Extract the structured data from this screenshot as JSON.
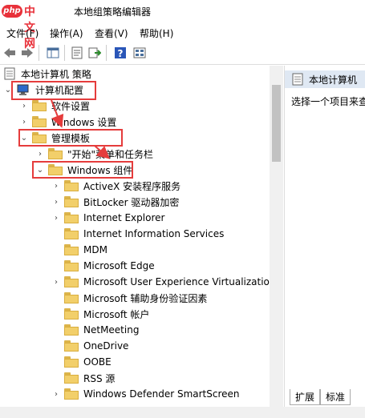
{
  "window": {
    "title": "本地组策略编辑器",
    "logo_text": "php",
    "logo_cn": "中文网"
  },
  "menu": [
    "文件(F)",
    "操作(A)",
    "查看(V)",
    "帮助(H)"
  ],
  "tree": {
    "root": "本地计算机 策略",
    "computer_config": "计算机配置",
    "software_settings": "软件设置",
    "windows_settings": "Windows 设置",
    "admin_templates": "管理模板",
    "start_menu": "\"开始\"菜单和任务栏",
    "windows_components": "Windows 组件",
    "components": [
      "ActiveX 安装程序服务",
      "BitLocker 驱动器加密",
      "Internet Explorer",
      "Internet Information Services",
      "MDM",
      "Microsoft Edge",
      "Microsoft User Experience Virtualization",
      "Microsoft 辅助身份验证因素",
      "Microsoft 帐户",
      "NetMeeting",
      "OneDrive",
      "OOBE",
      "RSS 源",
      "Windows Defender SmartScreen"
    ]
  },
  "right_pane": {
    "header": "本地计算机",
    "text": "选择一个项目来查"
  },
  "tabs": [
    "扩展",
    "标准"
  ],
  "colors": {
    "highlight": "#e53c3c",
    "folder": "#f2cf6a"
  }
}
